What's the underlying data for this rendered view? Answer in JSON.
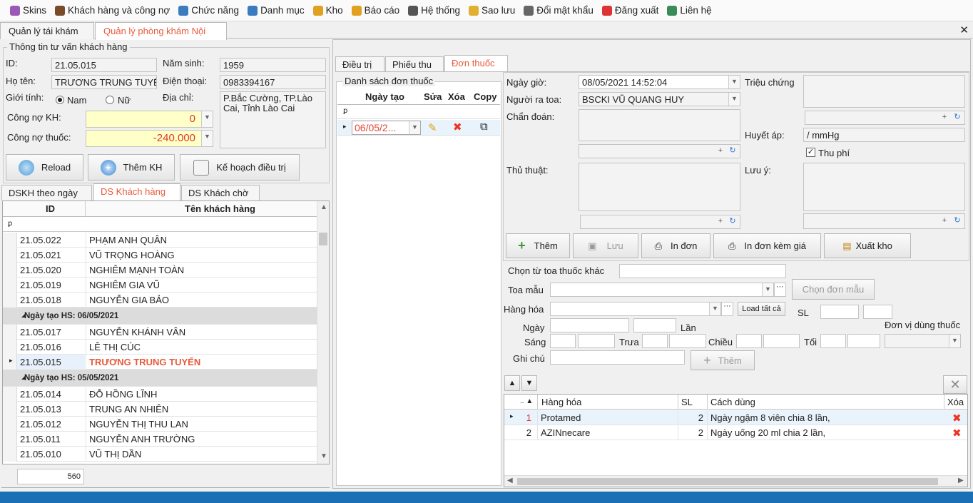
{
  "menu": [
    {
      "label": "Skins",
      "icon": "skins-icon",
      "color": "#9b59b6"
    },
    {
      "label": "Khách hàng và công nợ",
      "icon": "customer-icon",
      "color": "#7a4b2a"
    },
    {
      "label": "Chức năng",
      "icon": "function-icon",
      "color": "#3b7bbf"
    },
    {
      "label": "Danh mục",
      "icon": "category-icon",
      "color": "#3b7bbf"
    },
    {
      "label": "Kho",
      "icon": "warehouse-icon",
      "color": "#e0a020"
    },
    {
      "label": "Báo cáo",
      "icon": "report-icon",
      "color": "#e0a020"
    },
    {
      "label": "Hệ thống",
      "icon": "system-icon",
      "color": "#555"
    },
    {
      "label": "Sao lưu",
      "icon": "backup-icon",
      "color": "#e0b030"
    },
    {
      "label": "Đổi mật khẩu",
      "icon": "password-icon",
      "color": "#666"
    },
    {
      "label": "Đăng xuất",
      "icon": "logout-icon",
      "color": "#d33"
    },
    {
      "label": "Liên hệ",
      "icon": "contact-icon",
      "color": "#3a8a5a"
    }
  ],
  "form_tabs": [
    "Quản lý tái khám",
    "Quản lý phòng khám Nội"
  ],
  "close_glyph": "✕",
  "customer": {
    "title": "Thông tin tư vấn khách hàng",
    "id_label": "ID:",
    "id": "21.05.015",
    "birth_label": "Năm sinh:",
    "birth": "1959",
    "name_label": "Họ tên:",
    "name": "TRƯƠNG TRUNG TUYẾN",
    "phone_label": "Điện thoại:",
    "phone": "0983394167",
    "gender_label": "Giới tính:",
    "male": "Nam",
    "female": "Nữ",
    "address_label": "Địa chỉ:",
    "address": "P.Bắc Cường, TP.Lào Cai, Tỉnh Lào Cai",
    "debt_label": "Công nợ KH:",
    "debt": "0",
    "drug_debt_label": "Công nợ thuốc:",
    "drug_debt": "-240.000"
  },
  "buttons": {
    "reload": "Reload",
    "add_customer": "Thêm KH",
    "plan": "Kế hoạch điều trị"
  },
  "list_tabs": [
    "DSKH theo ngày",
    "DS Khách hàng",
    "DS Khách chờ"
  ],
  "cust_grid": {
    "headers": [
      "ID",
      "Tên khách hàng"
    ],
    "rows": [
      {
        "id": "21.05.022",
        "name": "PHẠM ANH QUÂN"
      },
      {
        "id": "21.05.021",
        "name": "VŨ TRỌNG HOÀNG"
      },
      {
        "id": "21.05.020",
        "name": "NGHIÊM MẠNH TOÀN"
      },
      {
        "id": "21.05.019",
        "name": "NGHIÊM GIA VŨ"
      },
      {
        "id": "21.05.018",
        "name": "NGUYỄN GIA BẢO"
      },
      {
        "group": "Ngày tạo HS: 06/05/2021"
      },
      {
        "id": "21.05.017",
        "name": "NGUYỄN KHÁNH VÂN"
      },
      {
        "id": "21.05.016",
        "name": "LÊ THỊ CÚC"
      },
      {
        "id": "21.05.015",
        "name": "TRƯƠNG TRUNG TUYẾN",
        "selected": true
      },
      {
        "group": "Ngày tạo HS: 05/05/2021"
      },
      {
        "id": "21.05.014",
        "name": "ĐỖ HỒNG LĨNH"
      },
      {
        "id": "21.05.013",
        "name": "TRUNG AN NHIÊN"
      },
      {
        "id": "21.05.012",
        "name": "NGUYỄN THỊ THU LAN"
      },
      {
        "id": "21.05.011",
        "name": "NGUYỄN ANH TRƯỜNG"
      },
      {
        "id": "21.05.010",
        "name": "VŨ THỊ DẦN"
      }
    ],
    "count": "560"
  },
  "right_tabs": [
    "Điều trị",
    "Phiếu thu",
    "Đơn thuốc"
  ],
  "rx_list": {
    "title": "Danh sách đơn thuốc",
    "headers": [
      "Ngày tạo",
      "Sửa",
      "Xóa",
      "Copy"
    ],
    "row_date": "06/05/2..."
  },
  "rx": {
    "datetime_label": "Ngày giờ:",
    "datetime": "08/05/2021 14:52:04",
    "doctor_label": "Người ra toa:",
    "doctor": "BSCKI VŨ QUANG HUY",
    "diagnosis_label": "Chẩn đoán:",
    "procedure_label": "Thủ thuật:",
    "symptom_label": "Triệu chứng",
    "bp_label": "Huyết áp:",
    "bp": "/ mmHg",
    "fee_label": "Thu phí",
    "note_label": "Lưu ý:"
  },
  "actions": [
    "Thêm",
    "Lưu",
    "In đơn",
    "In đơn kèm giá",
    "Xuất kho"
  ],
  "drug_form": {
    "choose_label": "Chọn từ toa thuốc khác",
    "template_label": "Toa mẫu",
    "choose_template": "Chọn đơn mẫu",
    "goods_label": "Hàng hóa",
    "load_all": "Load tất cả",
    "qty_label": "SL",
    "day_label": "Ngày",
    "times_label": "Lần",
    "unit_label": "Đơn vị dùng thuốc",
    "morning": "Sáng",
    "noon": "Trưa",
    "afternoon": "Chiều",
    "evening": "Tối",
    "note_label": "Ghi chú",
    "add": "Thêm"
  },
  "drug_grid": {
    "headers": [
      "Hàng hóa",
      "SL",
      "Cách dùng",
      "Xóa"
    ],
    "rows": [
      {
        "no": "1",
        "name": "Protamed",
        "qty": "2",
        "usage": "Ngày ngậm  8 viên chia 8 lần,"
      },
      {
        "no": "2",
        "name": "AZINnecare",
        "qty": "2",
        "usage": "Ngày uống 20 ml chia 2  lần,"
      }
    ]
  },
  "colors": {
    "accent": "#e8593a",
    "yellow_field": "#ffffc8",
    "status_bar": "#1b6fb5"
  }
}
